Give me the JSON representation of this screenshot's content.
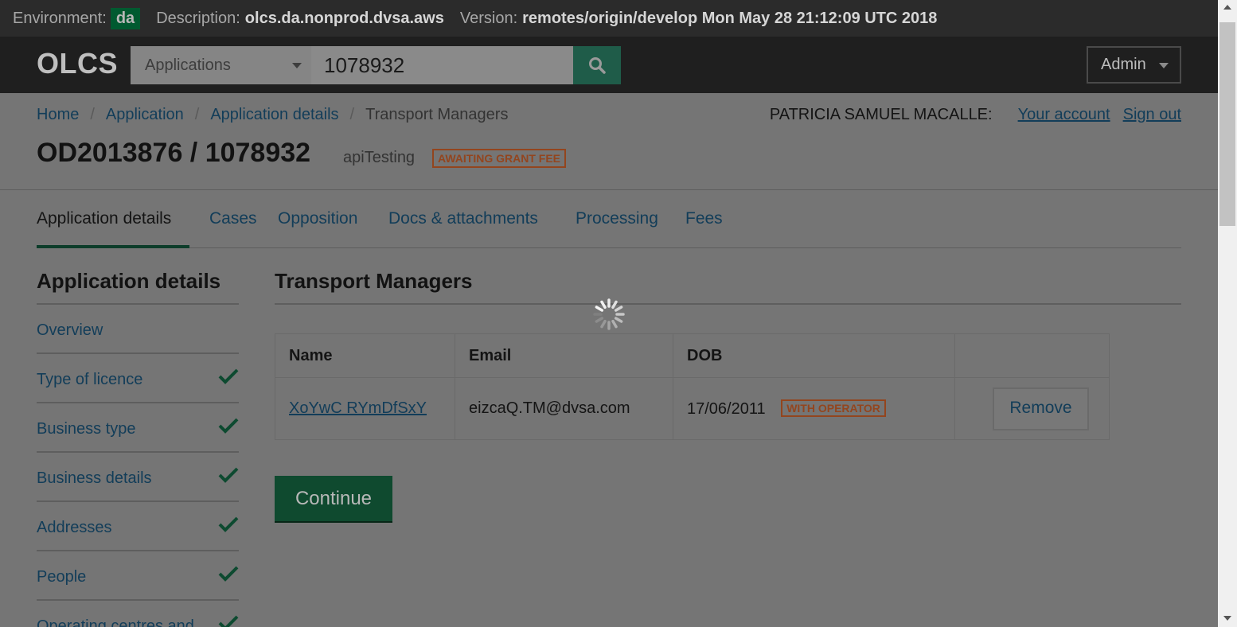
{
  "env_bar": {
    "environment_label": "Environment:",
    "environment_value": "da",
    "description_label": "Description:",
    "description_value": "olcs.da.nonprod.dvsa.aws",
    "version_label": "Version:",
    "version_value": "remotes/origin/develop Mon May 28 21:12:09 UTC 2018"
  },
  "header": {
    "logo": "OLCS",
    "search_type": "Applications",
    "search_value": "1078932",
    "search_icon": "search-icon",
    "admin_label": "Admin"
  },
  "breadcrumb": [
    "Home",
    "Application",
    "Application details",
    "Transport Managers"
  ],
  "user": {
    "name": "PATRICIA SAMUEL MACALLE:",
    "account_link": "Your account",
    "signout_link": "Sign out"
  },
  "page": {
    "title": "OD2013876 / 1078932",
    "subtitle": "apiTesting",
    "status_badge": "AWAITING GRANT FEE"
  },
  "tabs": [
    "Application details",
    "Cases",
    "Opposition",
    "Docs & attachments",
    "Processing",
    "Fees"
  ],
  "active_tab": "Application details",
  "sidenav": {
    "heading": "Application details",
    "items": [
      {
        "label": "Overview",
        "complete": false
      },
      {
        "label": "Type of licence",
        "complete": true
      },
      {
        "label": "Business type",
        "complete": true
      },
      {
        "label": "Business details",
        "complete": true
      },
      {
        "label": "Addresses",
        "complete": true
      },
      {
        "label": "People",
        "complete": true
      },
      {
        "label": "Operating centres and",
        "complete": true
      }
    ]
  },
  "main": {
    "heading": "Transport Managers",
    "table": {
      "columns": [
        "Name",
        "Email",
        "DOB",
        ""
      ],
      "rows": [
        {
          "name": "XoYwC RYmDfSxY",
          "email": "eizcaQ.TM@dvsa.com",
          "dob": "17/06/2011",
          "badge": "WITH OPERATOR",
          "action": "Remove"
        }
      ]
    },
    "continue_label": "Continue"
  },
  "colors": {
    "accent_green": "#00703c",
    "link_blue": "#1d70b8",
    "badge_orange": "#f47738",
    "overlay": "rgba(0,0,0,0.55)"
  }
}
